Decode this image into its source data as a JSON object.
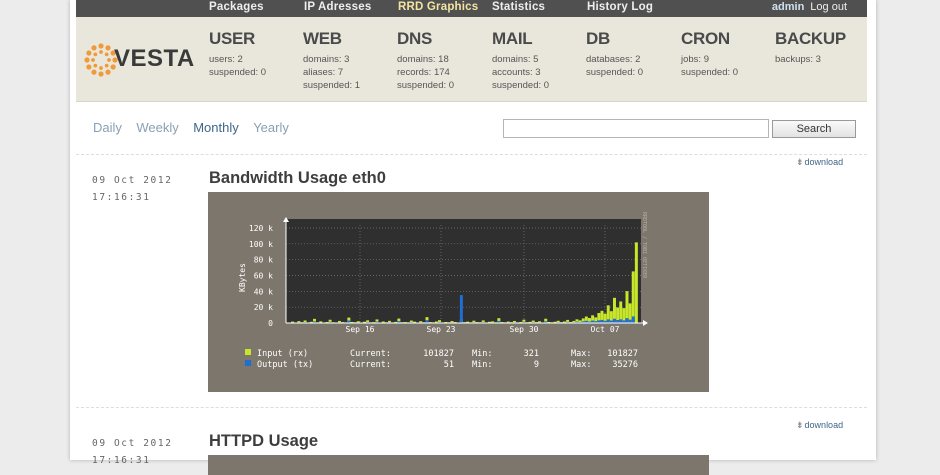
{
  "nav": {
    "items": [
      "Packages",
      "IP Adresses",
      "RRD Graphics",
      "Statistics",
      "History Log"
    ],
    "active": "RRD Graphics",
    "user": "admin",
    "logout": "Log out"
  },
  "logo": {
    "text": "VESTA",
    "color": "#f09a3a"
  },
  "stats": [
    {
      "title": "USER",
      "lines": [
        "users: 2",
        "suspended: 0"
      ]
    },
    {
      "title": "WEB",
      "lines": [
        "domains: 3",
        "aliases: 7",
        "suspended: 1"
      ]
    },
    {
      "title": "DNS",
      "lines": [
        "domains: 18",
        "records: 174",
        "suspended: 0"
      ]
    },
    {
      "title": "MAIL",
      "lines": [
        "domains: 5",
        "accounts: 3",
        "suspended: 0"
      ]
    },
    {
      "title": "DB",
      "lines": [
        "databases: 2",
        "suspended: 0"
      ]
    },
    {
      "title": "CRON",
      "lines": [
        "jobs: 9",
        "suspended: 0"
      ]
    },
    {
      "title": "BACKUP",
      "lines": [
        "backups: 3"
      ]
    }
  ],
  "periods": [
    "Daily",
    "Weekly",
    "Monthly",
    "Yearly"
  ],
  "active_period": "Monthly",
  "search": {
    "placeholder": "",
    "button": "Search"
  },
  "graphs": [
    {
      "date": "09 Oct 2012",
      "time": "17:16:31",
      "title": "Bandwidth Usage eth0",
      "download": "download",
      "ylabel": "KBytes",
      "yticks": [
        "120 k",
        "100 k",
        "80 k",
        "60 k",
        "40 k",
        "20 k",
        "0"
      ],
      "xticks": [
        "Sep 16",
        "Sep 23",
        "Sep 30",
        "Oct 07"
      ],
      "side_label": "RRDTOOL / TOBI OETIKER",
      "legend": [
        {
          "name": "Input (rx)",
          "current": "Current:",
          "current_value": "101827",
          "min": "Min:",
          "min_value": "321",
          "max": "Max:",
          "max_value": "101827",
          "color": "#c8e62a"
        },
        {
          "name": "Output (tx)",
          "current": "Current:",
          "current_value": "51",
          "min": "Min:",
          "min_value": "9",
          "max": "Max:",
          "max_value": "35276",
          "color": "#1f6fd1"
        }
      ]
    },
    {
      "date": "09 Oct 2012",
      "time": "17:16:31",
      "title": "HTTPD Usage",
      "download": "download"
    }
  ],
  "chart_data": {
    "type": "area",
    "xlabel": "",
    "ylabel": "KBytes",
    "ylim": [
      0,
      120000
    ],
    "xticks": [
      "Sep 16",
      "Sep 23",
      "Sep 30",
      "Oct 07"
    ],
    "grid": true,
    "series": [
      {
        "name": "Input (rx)",
        "color": "#c8e62a",
        "values": [
          600,
          1800,
          500,
          2400,
          900,
          3200,
          700,
          1500,
          5200,
          800,
          2100,
          600,
          1200,
          4100,
          900,
          700,
          2600,
          1100,
          800,
          6800,
          1300,
          900,
          2200,
          700,
          1600,
          3400,
          800,
          1100,
          4500,
          600,
          1900,
          900,
          2700,
          700,
          1400,
          5600,
          900,
          1200,
          800,
          3100,
          1700,
          600,
          2300,
          900,
          7400,
          1100,
          800,
          1900,
          3600,
          700,
          1300,
          900,
          2500,
          1200,
          600,
          4800,
          1000,
          1700,
          800,
          2900,
          1100,
          900,
          3300,
          700,
          1500,
          2100,
          900,
          6100,
          1200,
          800,
          1800,
          1000,
          2600,
          800,
          1300,
          4200,
          900,
          1400,
          3100,
          1100,
          2200,
          700,
          5400,
          1300,
          900,
          1600,
          2800,
          1000,
          1900,
          3900,
          1200,
          2600,
          4600,
          3300,
          5800,
          8200,
          6300,
          9700,
          7100,
          12600,
          15400,
          11800,
          22300,
          14900,
          31800,
          19600,
          27200,
          18800,
          40200,
          24800,
          65200,
          101827
        ]
      },
      {
        "name": "Output (tx)",
        "color": "#1f6fd1",
        "values": [
          200,
          600,
          150,
          900,
          300,
          1200,
          250,
          500,
          2100,
          300,
          700,
          200,
          400,
          1600,
          300,
          250,
          900,
          400,
          300,
          3200,
          500,
          300,
          800,
          250,
          600,
          1300,
          300,
          400,
          1900,
          200,
          700,
          300,
          1000,
          250,
          500,
          2400,
          300,
          400,
          300,
          1200,
          600,
          200,
          900,
          300,
          3600,
          400,
          300,
          700,
          1400,
          250,
          500,
          300,
          900,
          400,
          200,
          35276,
          400,
          600,
          300,
          1100,
          400,
          300,
          1300,
          250,
          500,
          800,
          300,
          2600,
          400,
          300,
          700,
          350,
          1000,
          300,
          500,
          1700,
          300,
          500,
          1200,
          400,
          800,
          250,
          2200,
          500,
          300,
          600,
          1100,
          350,
          700,
          1500,
          400,
          1000,
          1800,
          1200,
          2100,
          2800,
          1900,
          3100,
          2300,
          3400,
          3900,
          2800,
          4600,
          3200,
          5400,
          3800,
          4700,
          3300,
          6100,
          4200,
          8300,
          51
        ]
      }
    ]
  }
}
